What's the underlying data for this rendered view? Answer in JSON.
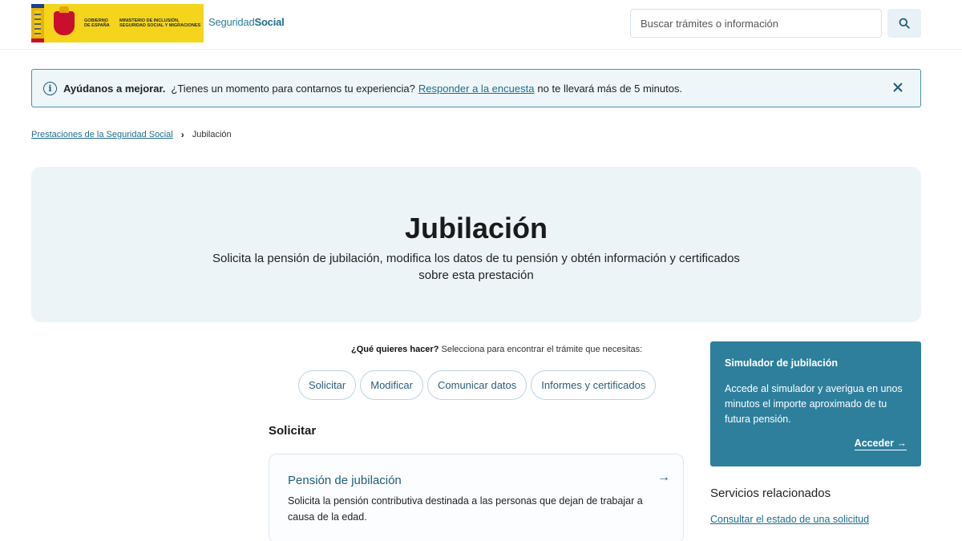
{
  "header": {
    "gov_text": "GOBIERNO DE ESPAÑA",
    "ministry_text": "MINISTERIO DE INCLUSIÓN, SEGURIDAD SOCIAL Y MIGRACIONES",
    "brand_light": "Seguridad",
    "brand_bold": "Social",
    "search_placeholder": "Buscar trámites o información",
    "search_icon": "search-icon"
  },
  "banner": {
    "bold": "Ayúdanos a mejorar.",
    "text_before": "¿Tienes un momento para contarnos tu experiencia?",
    "link": "Responder a la encuesta",
    "text_after": "no te llevará más de 5 minutos.",
    "close_icon": "close-icon"
  },
  "breadcrumb": {
    "parent": "Prestaciones de la Seguridad Social",
    "separator": "›",
    "current": "Jubilación"
  },
  "hero": {
    "title": "Jubilación",
    "subtitle": "Solicita la pensión de jubilación, modifica los datos de tu pensión y obtén información y certificados sobre esta prestación"
  },
  "filter": {
    "question_bold": "¿Qué quieres hacer?",
    "question_rest": "Selecciona para encontrar el trámite que necesitas:",
    "chips": [
      "Solicitar",
      "Modificar",
      "Comunicar datos",
      "Informes y certificados"
    ]
  },
  "solicitar": {
    "section_title": "Solicitar",
    "card_title": "Pensión de jubilación",
    "card_desc": "Solicita la pensión contributiva destinada a las personas que dejan de trabajar a causa de la edad.",
    "card_arrow": "→"
  },
  "simulator": {
    "title": "Simulador de jubilación",
    "desc": "Accede al simulador y averigua en unos minutos el importe aproximado de tu futura pensión.",
    "link": "Acceder",
    "link_arrow": "→"
  },
  "related": {
    "title": "Servicios relacionados",
    "link": "Consultar el estado de una solicitud"
  },
  "colors": {
    "accent": "#2d7f9c",
    "link": "#1f6d8c",
    "hero_bg": "#edf4f8"
  }
}
